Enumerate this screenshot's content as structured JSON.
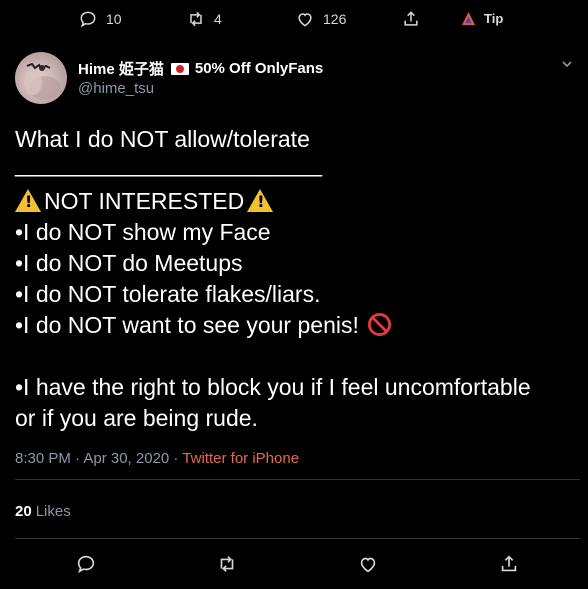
{
  "top_actions": {
    "replies": "10",
    "retweets": "4",
    "likes": "126",
    "tip": "Tip"
  },
  "author": {
    "display_name": "Hime 姫子猫",
    "promo": "50% Off OnlyFans",
    "handle": "@hime_tsu"
  },
  "tweet": {
    "lines": [
      "What I do NOT allow/tolerate",
      "________________________",
      "",
      "NOT INTERESTED",
      "•I do NOT show my Face",
      "•I do NOT do Meetups",
      "•I do NOT tolerate flakes/liars.",
      "•I do NOT want to see your penis!",
      "",
      "•I have the right to block you if I feel uncomfortable",
      "or if you are being rude."
    ]
  },
  "meta": {
    "timestamp": "8:30 PM · Apr 30, 2020 · ",
    "source": "Twitter for iPhone"
  },
  "stats": {
    "likes_count": "20",
    "likes_label": "Likes"
  },
  "colors": {
    "background": "#000000",
    "secondary_text": "#8899a6",
    "source_link": "#e56a4a",
    "divider": "#2f3336"
  }
}
